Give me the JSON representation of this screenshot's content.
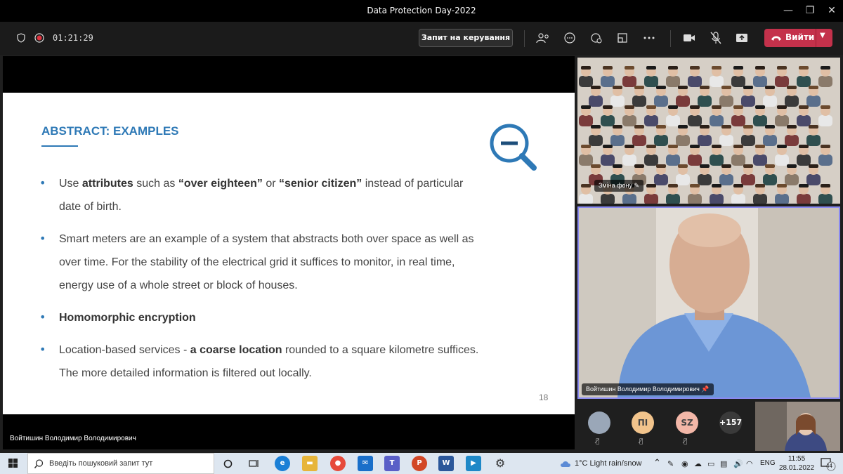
{
  "window": {
    "title": "Data Protection Day-2022"
  },
  "toolbar": {
    "timer": "01:21:29",
    "request_control": "Запит на керування",
    "leave_label": "Вийти"
  },
  "slide": {
    "title": "ABSTRACT: EXAMPLES",
    "page_number": "18",
    "bullets": [
      {
        "segments": [
          "Use ",
          "attributes",
          " such as ",
          "“over eighteen”",
          " or ",
          "“senior citizen”",
          " instead of particular date of birth."
        ]
      },
      {
        "text": "Smart meters are an example of a system that abstracts both over space as well as over time. For the stability of the electrical grid it suffices to monitor, in real time, energy use of a whole street or block of houses."
      },
      {
        "bold": "Homomorphic encryption"
      },
      {
        "segments": [
          "Location-based services - ",
          "a coarse location",
          " rounded to a square kilometre suffices. The more detailed information is filtered out locally."
        ]
      }
    ]
  },
  "presenter": {
    "name": "Войтишин Володимир Володимирович"
  },
  "videos": {
    "room_tag": "Зміна фону",
    "speaker_tag": "Войтишин Володимир Володимирович"
  },
  "roster": {
    "avatars": [
      "",
      "ПІ",
      "SZ"
    ],
    "more": "+157"
  },
  "taskbar": {
    "search_placeholder": "Введіть пошуковий запит тут",
    "weather": "1°C  Light rain/snow",
    "lang": "ENG",
    "time": "11:55",
    "date": "28.01.2022",
    "notif_count": "44"
  },
  "colors": {
    "accent": "#2e79b6",
    "leave": "#c4314b",
    "speaker_border": "#8a8af0"
  }
}
